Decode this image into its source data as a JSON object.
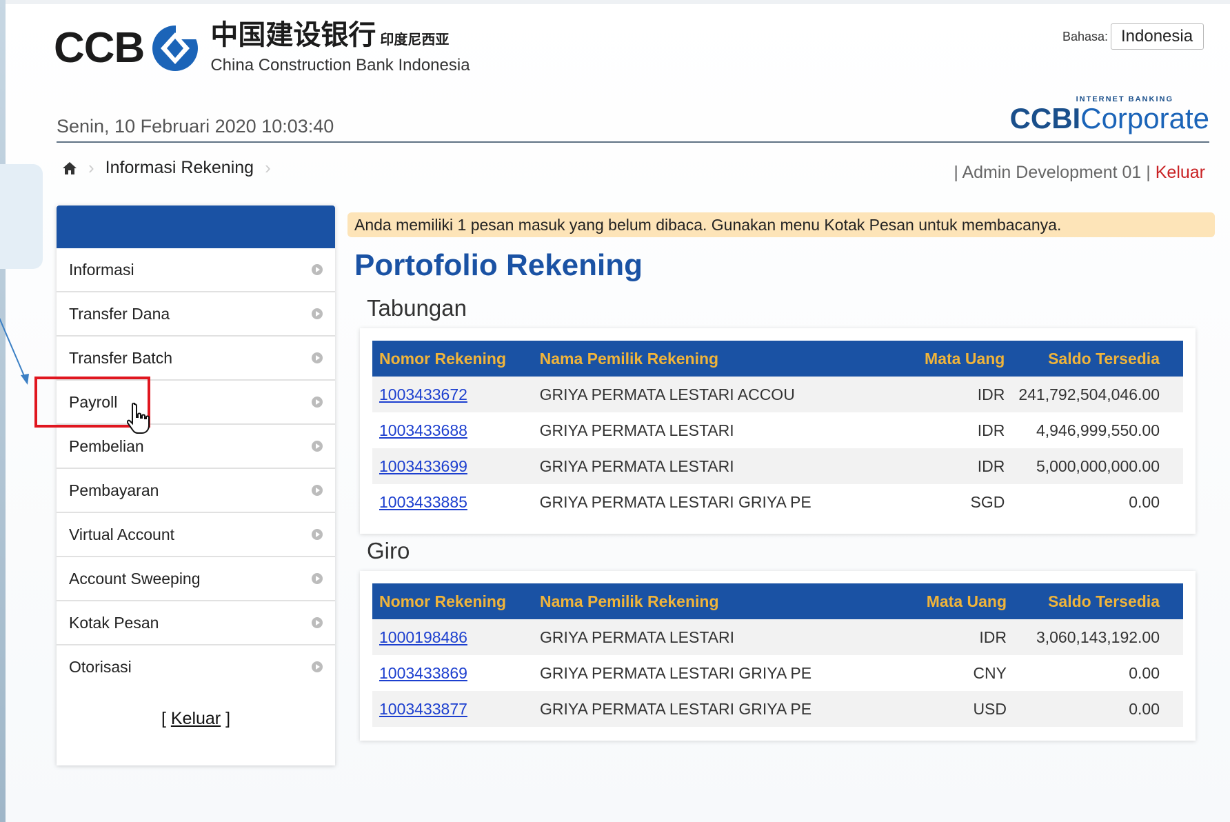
{
  "header": {
    "logo_ccb": "CCB",
    "logo_cn": "中国建设银行",
    "logo_cn_sub": "印度尼西亚",
    "logo_en": "China Construction Bank Indonesia",
    "language_label": "Bahasa:",
    "language_value": "Indonesia",
    "brand_small": "INTERNET BANKING",
    "brand_ccbi": "CCBI",
    "brand_corporate": "Corporate",
    "datetime": "Senin, 10 Februari 2020 10:03:40"
  },
  "breadcrumb": {
    "current": "Informasi Rekening"
  },
  "userbar": {
    "sep1": "|",
    "user": "Admin Development 01",
    "sep2": "|",
    "logout": "Keluar"
  },
  "sidebar": {
    "items": [
      {
        "label": "Informasi"
      },
      {
        "label": "Transfer Dana"
      },
      {
        "label": "Transfer Batch"
      },
      {
        "label": "Payroll"
      },
      {
        "label": "Pembelian"
      },
      {
        "label": "Pembayaran"
      },
      {
        "label": "Virtual Account"
      },
      {
        "label": "Account Sweeping"
      },
      {
        "label": "Kotak Pesan"
      },
      {
        "label": "Otorisasi"
      }
    ],
    "logout_label": "Keluar"
  },
  "notice": "Anda memiliki 1 pesan masuk yang belum dibaca. Gunakan menu Kotak Pesan untuk membacanya.",
  "page_title": "Portofolio Rekening",
  "columns": {
    "number": "Nomor Rekening",
    "name": "Nama Pemilik Rekening",
    "currency": "Mata Uang",
    "balance": "Saldo Tersedia"
  },
  "tabungan": {
    "title": "Tabungan",
    "rows": [
      {
        "number": "1003433672",
        "name": "GRIYA PERMATA LESTARI ACCOU",
        "currency": "IDR",
        "balance": "241,792,504,046.00"
      },
      {
        "number": "1003433688",
        "name": "GRIYA PERMATA LESTARI",
        "currency": "IDR",
        "balance": "4,946,999,550.00"
      },
      {
        "number": "1003433699",
        "name": "GRIYA PERMATA LESTARI",
        "currency": "IDR",
        "balance": "5,000,000,000.00"
      },
      {
        "number": "1003433885",
        "name": "GRIYA PERMATA LESTARI GRIYA PE",
        "currency": "SGD",
        "balance": "0.00"
      }
    ]
  },
  "giro": {
    "title": "Giro",
    "rows": [
      {
        "number": "1000198486",
        "name": "GRIYA PERMATA LESTARI",
        "currency": "IDR",
        "balance": "3,060,143,192.00"
      },
      {
        "number": "1003433869",
        "name": "GRIYA PERMATA LESTARI GRIYA PE",
        "currency": "CNY",
        "balance": "0.00"
      },
      {
        "number": "1003433877",
        "name": "GRIYA PERMATA LESTARI GRIYA PE",
        "currency": "USD",
        "balance": "0.00"
      }
    ]
  },
  "colors": {
    "primary": "#1a52a4",
    "header_text": "#f0b43a",
    "notice_bg": "#fde4b8",
    "link": "#1c3fcf",
    "logout": "#c92224",
    "highlight": "#e0161f"
  }
}
